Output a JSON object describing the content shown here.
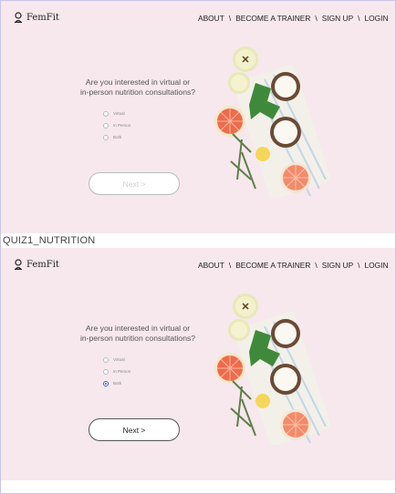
{
  "screens": [
    {
      "brand": "FemFit",
      "nav": [
        "ABOUT",
        "BECOME A TRAINER",
        "SIGN UP",
        "LOGIN"
      ],
      "nav_sep": "\\",
      "question_line1": "Are you interested in virtual or",
      "question_line2": "in-person nutrition consultations?",
      "options": [
        "Virtual",
        "In Person",
        "Both"
      ],
      "selected": null,
      "next_label": "Next >",
      "next_state": "disabled"
    },
    {
      "brand": "FemFit",
      "nav": [
        "ABOUT",
        "BECOME A TRAINER",
        "SIGN UP",
        "LOGIN"
      ],
      "nav_sep": "\\",
      "question_line1": "Are you interested in virtual or",
      "question_line2": "in-person nutrition consultations?",
      "options": [
        "Virtual",
        "In Person",
        "Both"
      ],
      "selected": "Both",
      "next_label": "Next >",
      "next_state": "enabled"
    }
  ],
  "frame_label": "QUIZ1_NUTRITION",
  "colors": {
    "background": "#f6e8ec",
    "radio_selected": "#3b5cc4",
    "frame_border": "#c9c3ea"
  },
  "icons": {
    "logo": "person-icon",
    "illustration": "fruit-flatlay-image"
  }
}
